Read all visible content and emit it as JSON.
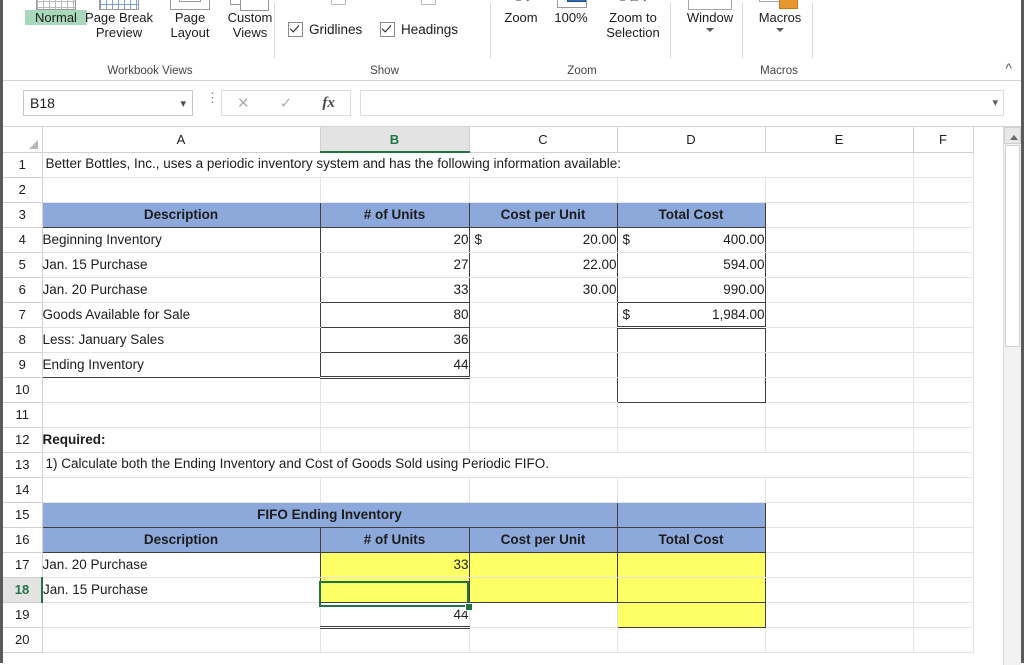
{
  "ribbon": {
    "groups": [
      {
        "name": "Workbook Views",
        "label": "Workbook Views"
      },
      {
        "name": "Show",
        "label": "Show"
      },
      {
        "name": "Zoom",
        "label": "Zoom"
      },
      {
        "name": "Macros",
        "label": "Macros"
      }
    ],
    "workbook_views": {
      "normal": "Normal",
      "page_break_preview": "Page Break\nPreview",
      "page_break_preview_l1": "Page Break",
      "page_break_preview_l2": "Preview",
      "page_layout_l1": "Page",
      "page_layout_l2": "Layout",
      "custom_views_l1": "Custom",
      "custom_views_l2": "Views"
    },
    "show": {
      "gridlines": "Gridlines",
      "gridlines_checked": true,
      "headings": "Headings",
      "headings_checked": true
    },
    "zoom_group": {
      "zoom": "Zoom",
      "zoom_100": "100%",
      "zoom_badge": "100",
      "zoom_to_selection_l1": "Zoom to",
      "zoom_to_selection_l2": "Selection"
    },
    "window_group": {
      "window": "Window"
    },
    "macros_group": {
      "macros": "Macros"
    },
    "collapse_icon": "chevron-up"
  },
  "formula_bar": {
    "name_box_value": "B18",
    "cancel_icon": "✕",
    "enter_icon": "✓",
    "fx_icon": "fx",
    "formula_value": "",
    "formula_placeholder": ""
  },
  "grid": {
    "columns": [
      "A",
      "B",
      "C",
      "D",
      "E",
      "F"
    ],
    "selected_column": "B",
    "selected_row": 18,
    "selected_cell": "B18",
    "rows": [
      {
        "n": 1,
        "cells": {
          "A": "Better Bottles, Inc., uses a periodic inventory system and has the following information available:"
        }
      },
      {
        "n": 2,
        "cells": {}
      },
      {
        "n": 3,
        "cells": {
          "A": "Description",
          "B": "# of Units",
          "C": "Cost per Unit",
          "D": "Total Cost"
        }
      },
      {
        "n": 4,
        "cells": {
          "A": "Beginning Inventory",
          "B": "20",
          "C_sym": "$",
          "C": "20.00",
          "D_sym": "$",
          "D": "400.00"
        }
      },
      {
        "n": 5,
        "cells": {
          "A": "Jan. 15 Purchase",
          "B": "27",
          "C": "22.00",
          "D": "594.00"
        }
      },
      {
        "n": 6,
        "cells": {
          "A": "Jan. 20 Purchase",
          "B": "33",
          "C": "30.00",
          "D": "990.00"
        }
      },
      {
        "n": 7,
        "cells": {
          "A": "Goods Available for Sale",
          "B": "80",
          "D_sym": "$",
          "D": "1,984.00"
        }
      },
      {
        "n": 8,
        "cells": {
          "A": "Less: January Sales",
          "B": "36"
        }
      },
      {
        "n": 9,
        "cells": {
          "A": "Ending Inventory",
          "B": "44"
        }
      },
      {
        "n": 10,
        "cells": {}
      },
      {
        "n": 11,
        "cells": {}
      },
      {
        "n": 12,
        "cells": {
          "A": "Required:"
        }
      },
      {
        "n": 13,
        "cells": {
          "A": "1) Calculate both the Ending Inventory and Cost of Goods Sold using Periodic FIFO."
        }
      },
      {
        "n": 14,
        "cells": {}
      },
      {
        "n": 15,
        "cells": {
          "A": "FIFO Ending Inventory"
        }
      },
      {
        "n": 16,
        "cells": {
          "A": "Description",
          "B": "# of Units",
          "C": "Cost per Unit",
          "D": "Total Cost"
        }
      },
      {
        "n": 17,
        "cells": {
          "A": "Jan. 20 Purchase",
          "B": "33",
          "C": "",
          "D": ""
        }
      },
      {
        "n": 18,
        "cells": {
          "A": "Jan. 15 Purchase",
          "B": "",
          "C": "",
          "D": ""
        }
      },
      {
        "n": 19,
        "cells": {
          "B": "44",
          "D": ""
        }
      },
      {
        "n": 20,
        "cells": {}
      }
    ],
    "colors": {
      "header_blue": "#8DA9DB",
      "input_yellow": "#FFFF66",
      "selection_green": "#217346"
    }
  }
}
